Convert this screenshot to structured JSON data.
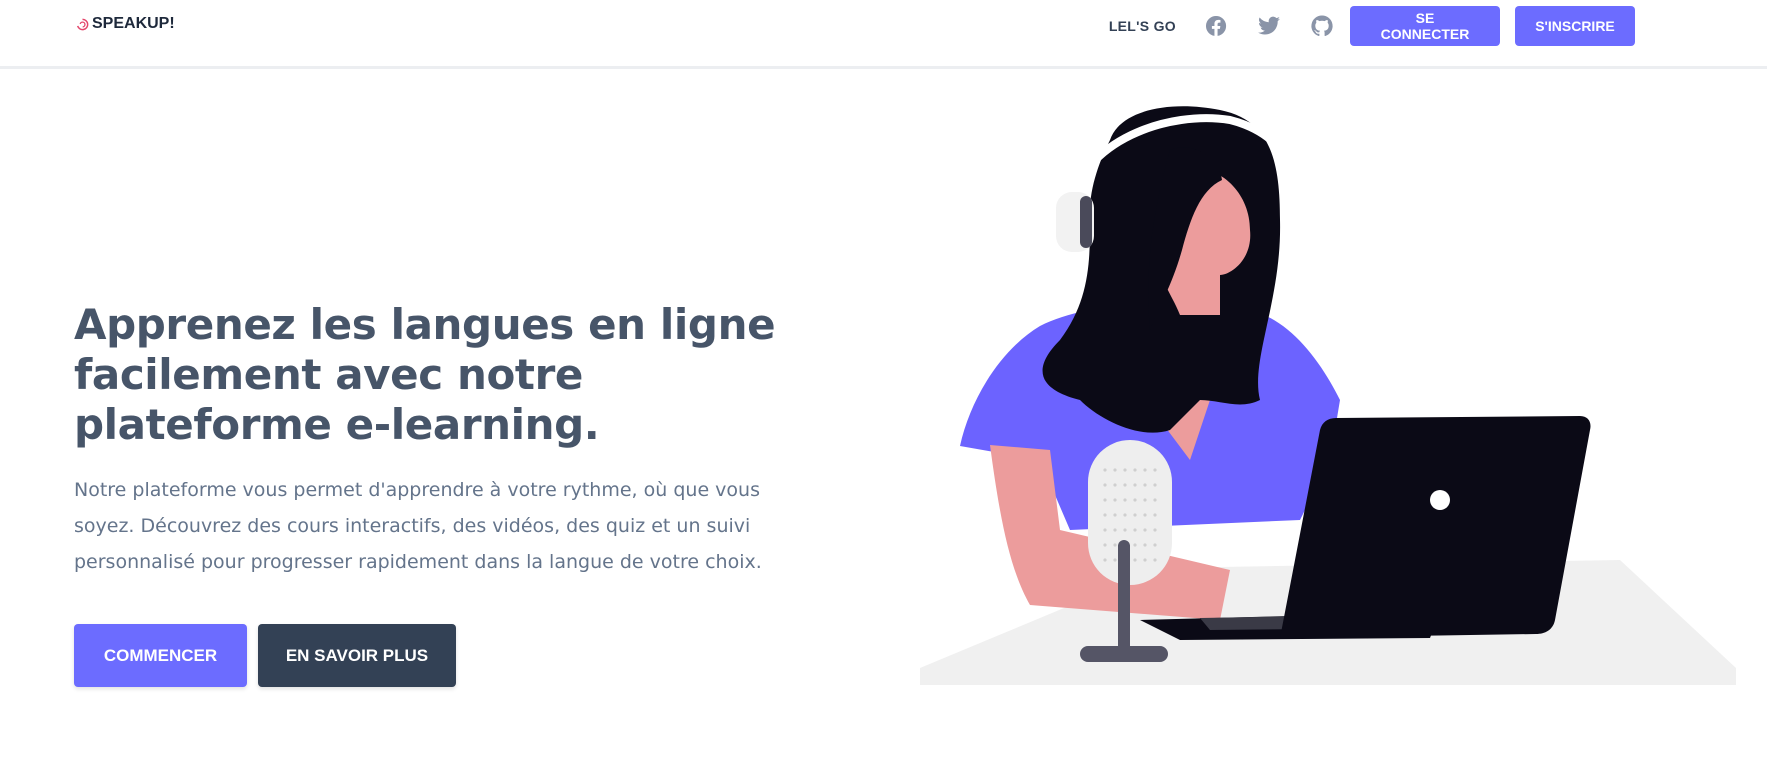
{
  "navbar": {
    "brand": "SPEAKUP!",
    "link_label": "LEL'S GO",
    "social_icons": [
      "facebook-icon",
      "twitter-icon",
      "github-icon"
    ],
    "login_label": "SE CONNECTER",
    "signup_label": "S'INSCRIRE"
  },
  "hero": {
    "title": "Apprenez les langues en ligne facilement avec notre plateforme e-learning.",
    "description": "Notre plateforme vous permet d'apprendre à votre rythme, où que vous soyez. Découvrez des cours interactifs, des vidéos, des quiz et un suivi personnalisé pour progresser rapidement dans la langue de votre choix.",
    "primary_cta": "COMMENCER",
    "secondary_cta": "EN SAVOIR PLUS"
  },
  "theme": {
    "accent": "#6c6cff",
    "dark_button": "#334155",
    "heading": "#475569",
    "body_text": "#64748b",
    "skin": "#ec9c9c",
    "hair": "#0b0a16",
    "shirt": "#6c63ff"
  }
}
